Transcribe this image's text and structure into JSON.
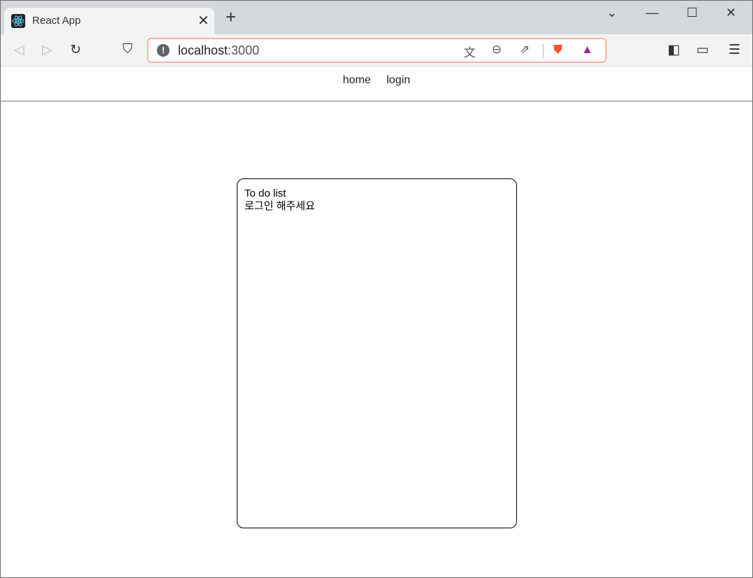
{
  "browser": {
    "tab_title": "React App",
    "url_host": "localhost",
    "url_port": ":3000",
    "accent": "#f7b2a6"
  },
  "icons": [
    "react-icon",
    "close-icon",
    "plus-icon",
    "chevron-down-icon",
    "minimize-icon",
    "maximize-icon",
    "back-icon",
    "forward-icon",
    "reload-icon",
    "bookmark-icon",
    "info-icon",
    "translate-icon",
    "zoom-out-icon",
    "share-icon",
    "brave-shields-icon",
    "brave-rewards-icon",
    "sidebar-icon",
    "wallet-icon",
    "menu-icon"
  ],
  "nav": {
    "items": [
      {
        "label": "home"
      },
      {
        "label": "login"
      }
    ]
  },
  "todo": {
    "title": "To do list",
    "message": "로그인 해주세요"
  }
}
